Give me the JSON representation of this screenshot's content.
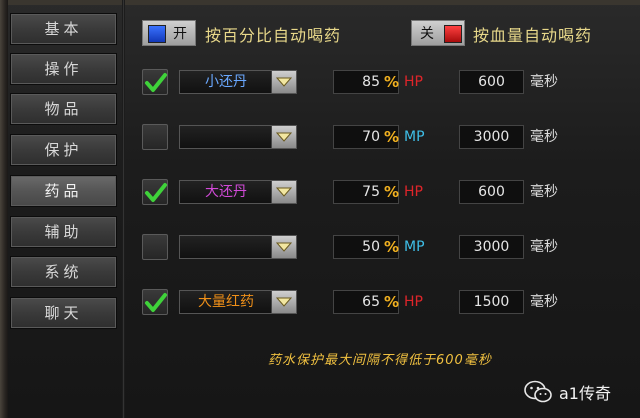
{
  "sidebar": {
    "items": [
      {
        "label": "基本",
        "active": false
      },
      {
        "label": "操作",
        "active": false
      },
      {
        "label": "物品",
        "active": false
      },
      {
        "label": "保护",
        "active": false
      },
      {
        "label": "药品",
        "active": true
      },
      {
        "label": "辅助",
        "active": false
      },
      {
        "label": "系统",
        "active": false
      },
      {
        "label": "聊天",
        "active": false
      }
    ]
  },
  "toggles": {
    "percent": {
      "state_label": "开",
      "label": "按百分比自动喝药",
      "color": "#1f4fd8"
    },
    "hp_amount": {
      "state_label": "关",
      "label": "按血量自动喝药",
      "color": "#d81a1a"
    }
  },
  "rows": [
    {
      "checked": true,
      "potion": "小还丹",
      "potion_color": "#6aa8ff",
      "percent": "85",
      "unit": "HP",
      "unit_color": "#e0252a",
      "interval": "600",
      "ms_label": "毫秒"
    },
    {
      "checked": false,
      "potion": "",
      "potion_color": "#dddddd",
      "percent": "70",
      "unit": "MP",
      "unit_color": "#3fbfe8",
      "interval": "3000",
      "ms_label": "毫秒"
    },
    {
      "checked": true,
      "potion": "大还丹",
      "potion_color": "#d24ad8",
      "percent": "75",
      "unit": "HP",
      "unit_color": "#e0252a",
      "interval": "600",
      "ms_label": "毫秒"
    },
    {
      "checked": false,
      "potion": "",
      "potion_color": "#dddddd",
      "percent": "50",
      "unit": "MP",
      "unit_color": "#3fbfe8",
      "interval": "3000",
      "ms_label": "毫秒"
    },
    {
      "checked": true,
      "potion": "大量红药",
      "potion_color": "#f09018",
      "percent": "65",
      "unit": "HP",
      "unit_color": "#e0252a",
      "interval": "1500",
      "ms_label": "毫秒"
    }
  ],
  "percent_symbol": "%",
  "note": "药水保护最大间隔不得低于600毫秒",
  "watermark": "a1传奇",
  "icons": {
    "check": "check-icon",
    "dropdown": "chevron-down-icon",
    "wechat": "wechat-icon"
  }
}
